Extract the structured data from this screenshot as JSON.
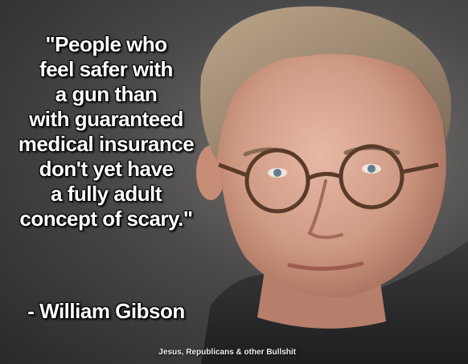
{
  "quote": {
    "lines": [
      "\"People who",
      "feel safer with",
      "a gun than",
      "with guaranteed",
      "medical insurance",
      "don't yet have",
      "a fully adult",
      "concept of scary.\""
    ]
  },
  "author": "- William Gibson",
  "watermark": "Jesus, Republicans & other Bullshit",
  "colors": {
    "background_dark": "#2a2929",
    "text": "#ffffff",
    "skin": "#d9a48f",
    "hair": "#a08a73"
  }
}
